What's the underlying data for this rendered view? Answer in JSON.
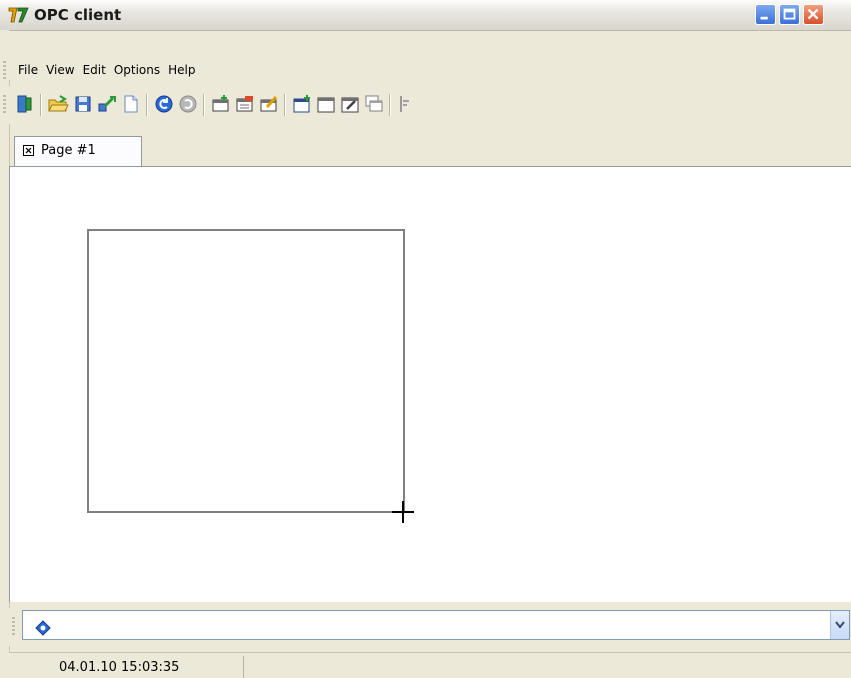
{
  "window": {
    "title": "OPC client",
    "controls": [
      "minimize",
      "maximize",
      "close"
    ]
  },
  "menu": {
    "items": [
      "File",
      "View",
      "Edit",
      "Options",
      "Help"
    ]
  },
  "toolbar": {
    "buttons": [
      "exit-icon",
      "open-icon",
      "save-icon",
      "connect-icon",
      "new-icon",
      "undo-icon",
      "redo-icon",
      "folder-add-icon",
      "folder-list-icon",
      "folder-edit-icon",
      "window-add-icon",
      "window-icon",
      "window-edit-icon",
      "window-stack-icon",
      "align-icon"
    ]
  },
  "tabs": [
    {
      "label": "Page #1",
      "active": true
    }
  ],
  "messages": {
    "current": ""
  },
  "status": {
    "datetime": "04.01.10 15:03:35"
  },
  "colors": {
    "frame": "#ece9d8",
    "canvas": "#ffffff",
    "shape_border": "#808080"
  }
}
